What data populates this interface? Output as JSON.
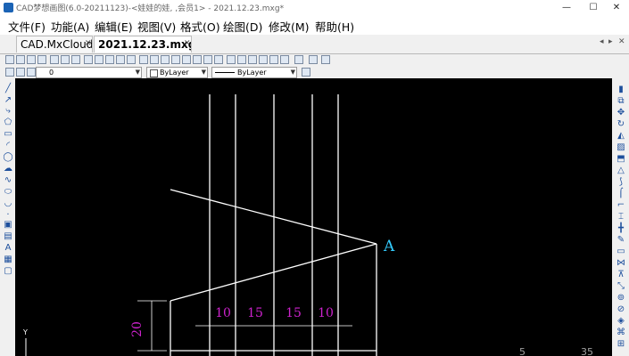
{
  "titlebar": {
    "title": "CAD梦想画图(6.0-20211123)-<娃娃的娃, ,会员1> - 2021.12.23.mxg*",
    "minimize": "—",
    "maximize": "☐",
    "close": "✕"
  },
  "menu": [
    {
      "label": "文件(F)"
    },
    {
      "label": "功能(A)"
    },
    {
      "label": "编辑(E)"
    },
    {
      "label": "视图(V)"
    },
    {
      "label": "格式(O)"
    },
    {
      "label": "绘图(D)"
    },
    {
      "label": "修改(M)"
    },
    {
      "label": "帮助(H)"
    }
  ],
  "tabs": [
    {
      "label": "CAD.MxCloud",
      "close": "✕",
      "active": false
    },
    {
      "label": "2021.12.23.mxg*",
      "close": "✕",
      "active": true
    }
  ],
  "tabbar_controls": {
    "prev": "◂",
    "next": "▸",
    "close": "✕"
  },
  "properties": {
    "layer_value": "0",
    "color_value": "ByLayer",
    "linetype_value": "ByLayer"
  },
  "drawing": {
    "label_A": "A",
    "dim_values": [
      "10",
      "15",
      "15",
      "10"
    ],
    "dim_vertical": "20",
    "axis_label": "Y",
    "coord_left": "5",
    "coord_right": "35",
    "colors": {
      "lines": "#ffffff",
      "dims": "#cc22cc",
      "label": "#33ccff",
      "canvas": "#000000"
    }
  }
}
